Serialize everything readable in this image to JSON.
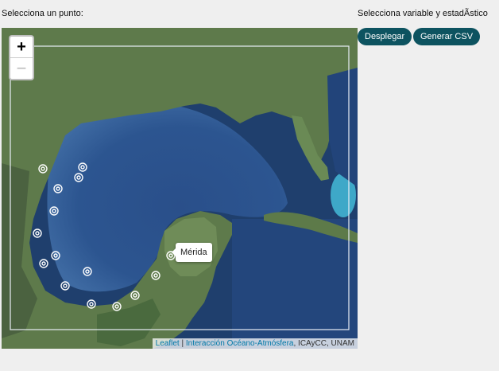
{
  "left_label": "Selecciona un punto:",
  "right_label": "Selecciona variable y estadÃstico",
  "buttons": {
    "display": "Desplegar",
    "csv": "Generar CSV"
  },
  "zoom": {
    "in": "+",
    "out": "−"
  },
  "tooltip": "Mérida",
  "attribution": {
    "leaflet": "Leaflet",
    "sep": "|",
    "interaccion": "Interacción Océano-Atmósfera",
    "rest": ", ICAyCC, UNAM"
  },
  "colors": {
    "button": "#0d5360",
    "ocean": "#1f3f6d",
    "land": "#5e7a4b"
  }
}
